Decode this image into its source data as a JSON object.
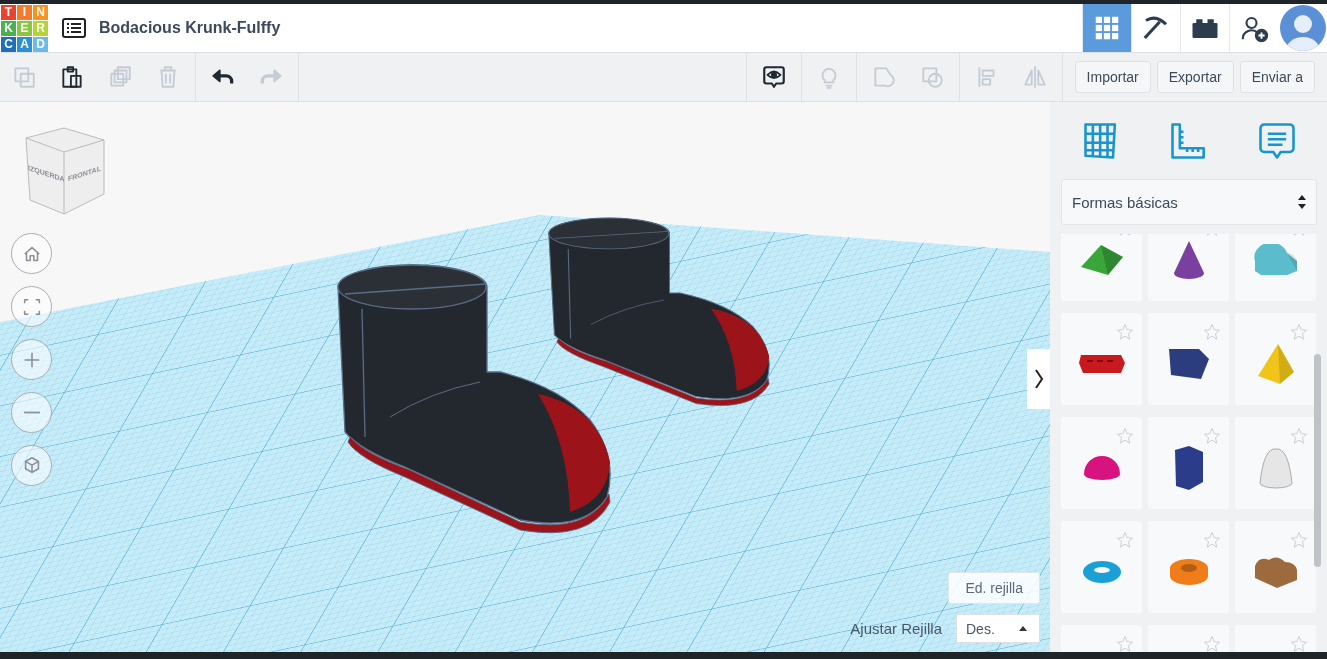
{
  "logo": {
    "letters": [
      {
        "text": "T",
        "color": "#e8432d"
      },
      {
        "text": "I",
        "color": "#f47b2a"
      },
      {
        "text": "N",
        "color": "#f7941d"
      },
      {
        "text": "K",
        "color": "#4caf50"
      },
      {
        "text": "E",
        "color": "#8cc63f"
      },
      {
        "text": "R",
        "color": "#b5d334"
      },
      {
        "text": "C",
        "color": "#1d6fb8"
      },
      {
        "text": "A",
        "color": "#2e8fd3"
      },
      {
        "text": "D",
        "color": "#6cbbe6"
      }
    ]
  },
  "header": {
    "title": "Bodacious Krunk-Fulffy",
    "apps": [
      {
        "kind": "grid",
        "selected": true
      },
      {
        "kind": "pickaxe",
        "selected": false
      },
      {
        "kind": "bricks",
        "selected": false
      },
      {
        "kind": "add-user",
        "selected": false
      }
    ]
  },
  "toolbar": {
    "left_groups": [
      {
        "items": [
          {
            "kind": "copy",
            "disabled": true
          },
          {
            "kind": "paste",
            "disabled": false
          },
          {
            "kind": "duplicate",
            "disabled": true
          },
          {
            "kind": "delete",
            "disabled": true
          }
        ]
      },
      {
        "items": [
          {
            "kind": "undo",
            "disabled": false
          },
          {
            "kind": "redo",
            "disabled": true
          }
        ]
      }
    ],
    "right_groups": [
      {
        "items": [
          {
            "kind": "notes-eye",
            "disabled": false
          }
        ]
      },
      {
        "items": [
          {
            "kind": "bulb",
            "disabled": true
          }
        ]
      },
      {
        "items": [
          {
            "kind": "group",
            "disabled": true
          },
          {
            "kind": "ungroup",
            "disabled": true
          }
        ]
      },
      {
        "items": [
          {
            "kind": "align",
            "disabled": true
          },
          {
            "kind": "mirror",
            "disabled": true
          }
        ]
      }
    ],
    "buttons": [
      "Importar",
      "Exportar",
      "Enviar a"
    ]
  },
  "view_cube": {
    "faces": [
      "IZQUERDA",
      "FRONTAL"
    ]
  },
  "nav_controls": [
    {
      "kind": "home"
    },
    {
      "kind": "fit"
    },
    {
      "kind": "zoom-in"
    },
    {
      "kind": "zoom-out"
    },
    {
      "kind": "perspective"
    }
  ],
  "grid_controls": {
    "edit_button": "Ed. rejilla",
    "snap_label": "Ajustar Rejilla",
    "snap_value": "Des."
  },
  "panel": {
    "tools": [
      {
        "kind": "workplane"
      },
      {
        "kind": "ruler"
      },
      {
        "kind": "notes"
      }
    ],
    "category": "Formas básicas",
    "shapes": [
      {
        "kind": "roof",
        "color": "#3aa63a"
      },
      {
        "kind": "cone",
        "color": "#7b3fa0"
      },
      {
        "kind": "half-cylinder",
        "color": "#5bbccc"
      },
      {
        "kind": "text",
        "color": "#c8191f"
      },
      {
        "kind": "box",
        "color": "#2b3d7f"
      },
      {
        "kind": "pyramid",
        "color": "#f0c419"
      },
      {
        "kind": "half-sphere",
        "color": "#d6137f"
      },
      {
        "kind": "hexagon",
        "color": "#2b3d8a"
      },
      {
        "kind": "paraboloid",
        "color": "#e6e6e6"
      },
      {
        "kind": "torus",
        "color": "#1a9fd6"
      },
      {
        "kind": "tube",
        "color": "#ee7d1a"
      },
      {
        "kind": "heart",
        "color": "#9c6a3c"
      },
      {
        "kind": "hidden"
      },
      {
        "kind": "hidden"
      },
      {
        "kind": "hidden"
      }
    ]
  }
}
